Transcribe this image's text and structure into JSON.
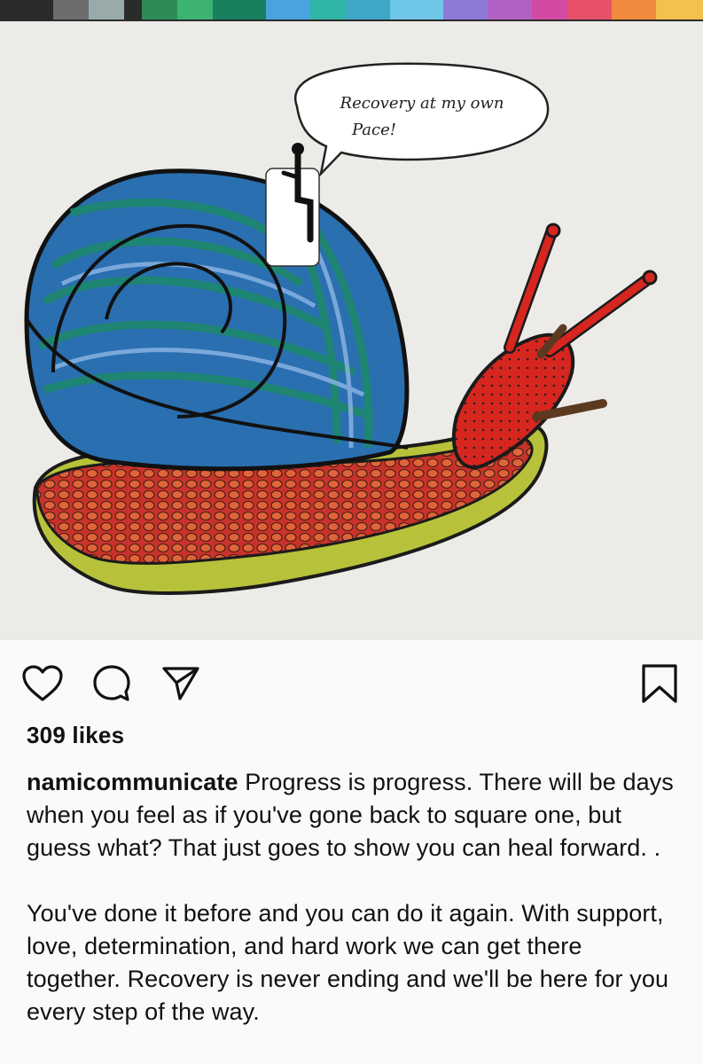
{
  "post": {
    "image_alt": "snail-drawing",
    "speech_bubble_text_line1": "Recovery at my own",
    "speech_bubble_text_line2": "Pace!",
    "likes_text": "309 likes",
    "username": "namicommunicate",
    "caption_p1": "Progress is progress. There will be days when you feel as if you've gone back to square one, but guess what? That just goes to show you can heal forward. .",
    "caption_p2": "You've done it before and you can do it again. With support, love, determination, and hard work we can get there together. Recovery is never ending and we'll be here for you every step of the way."
  },
  "actions": {
    "like_icon": "heart-icon",
    "comment_icon": "comment-icon",
    "share_icon": "paper-plane-icon",
    "save_icon": "bookmark-icon"
  },
  "colors": {
    "background": "#fafafa",
    "text": "#111111",
    "paper": "#ecebe8"
  }
}
